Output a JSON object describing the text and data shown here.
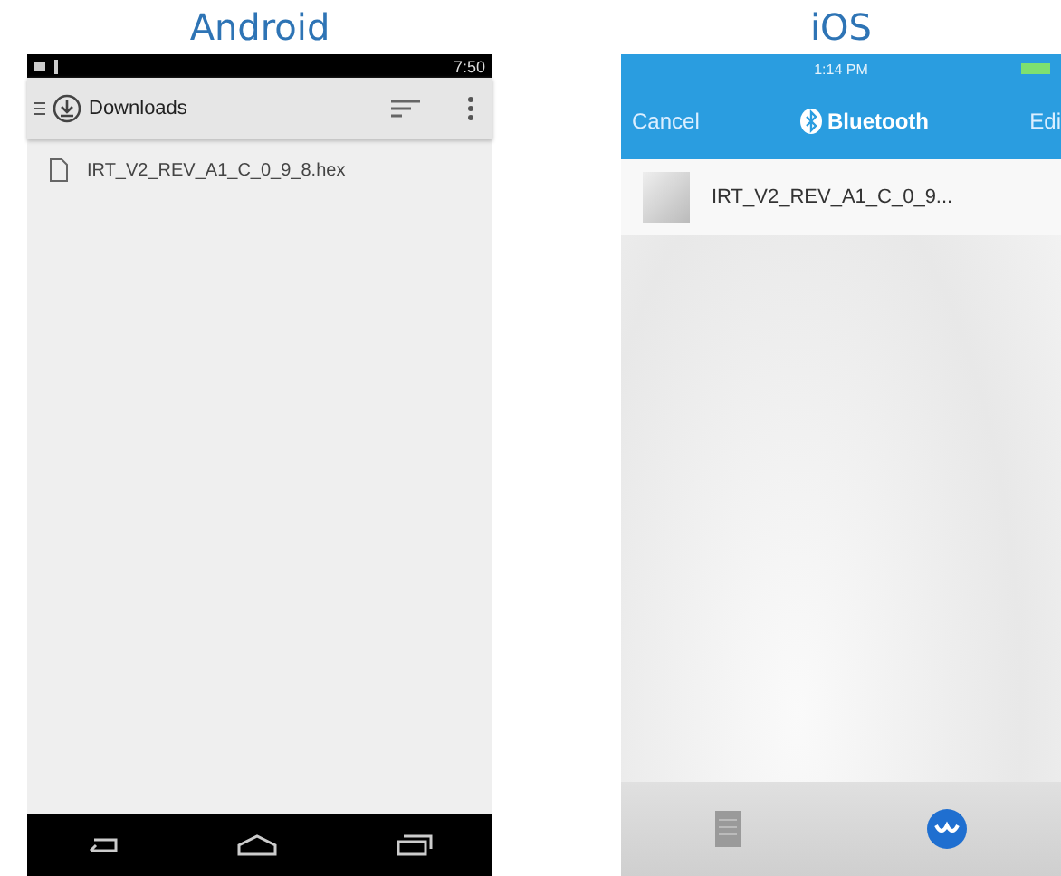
{
  "android": {
    "caption": "Android",
    "status_bar": {
      "time": "7:50"
    },
    "toolbar": {
      "title": "Downloads"
    },
    "files": [
      {
        "name": "IRT_V2_REV_A1_C_0_9_8.hex"
      }
    ]
  },
  "ios": {
    "caption": "iOS",
    "status_bar": {
      "time": "1:14 PM"
    },
    "nav_bar": {
      "left": "Cancel",
      "title": "Bluetooth",
      "right": "Edi"
    },
    "files": [
      {
        "name": "IRT_V2_REV_A1_C_0_9..."
      }
    ],
    "tabs": [
      {
        "selected": false
      },
      {
        "selected": true
      }
    ]
  }
}
